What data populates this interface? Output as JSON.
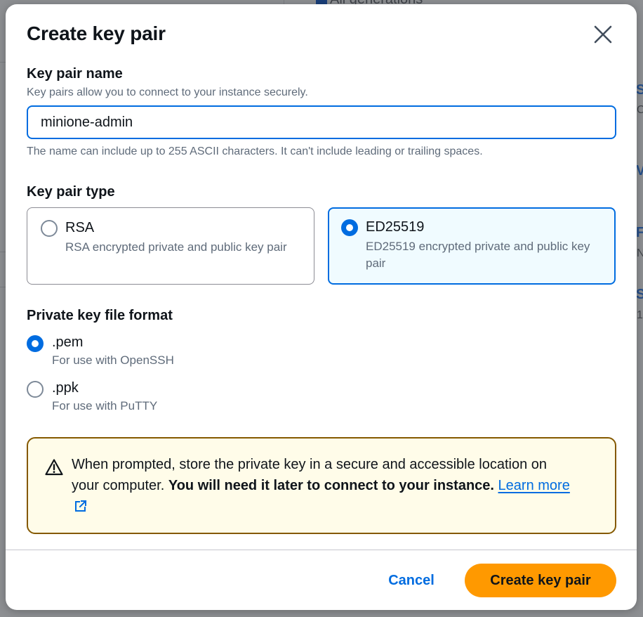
{
  "background": {
    "header_fragment": "All generations"
  },
  "modal": {
    "title": "Create key pair",
    "close_icon": "close-icon",
    "key_name": {
      "label": "Key pair name",
      "description": "Key pairs allow you to connect to your instance securely.",
      "value": "minione-admin",
      "constraint": "The name can include up to 255 ASCII characters. It can't include leading or trailing spaces."
    },
    "key_type": {
      "label": "Key pair type",
      "options": [
        {
          "title": "RSA",
          "description": "RSA encrypted private and public key pair",
          "selected": false
        },
        {
          "title": "ED25519",
          "description": "ED25519 encrypted private and public key pair",
          "selected": true
        }
      ]
    },
    "file_format": {
      "label": "Private key file format",
      "options": [
        {
          "title": ".pem",
          "description": "For use with OpenSSH",
          "selected": true
        },
        {
          "title": ".ppk",
          "description": "For use with PuTTY",
          "selected": false
        }
      ]
    },
    "alert": {
      "icon": "warning-icon",
      "text_plain": "When prompted, store the private key in a secure and accessible location on your computer. ",
      "text_bold": "You will need it later to connect to your instance.",
      "link_label": "Learn more",
      "link_icon": "external-link-icon"
    },
    "footer": {
      "cancel_label": "Cancel",
      "create_label": "Create key pair"
    }
  },
  "colors": {
    "accent": "#006ce0",
    "primary_button": "#ff9900",
    "alert_border": "#855900",
    "alert_background": "#fffce9",
    "selected_tile_background": "#f0fbff"
  }
}
